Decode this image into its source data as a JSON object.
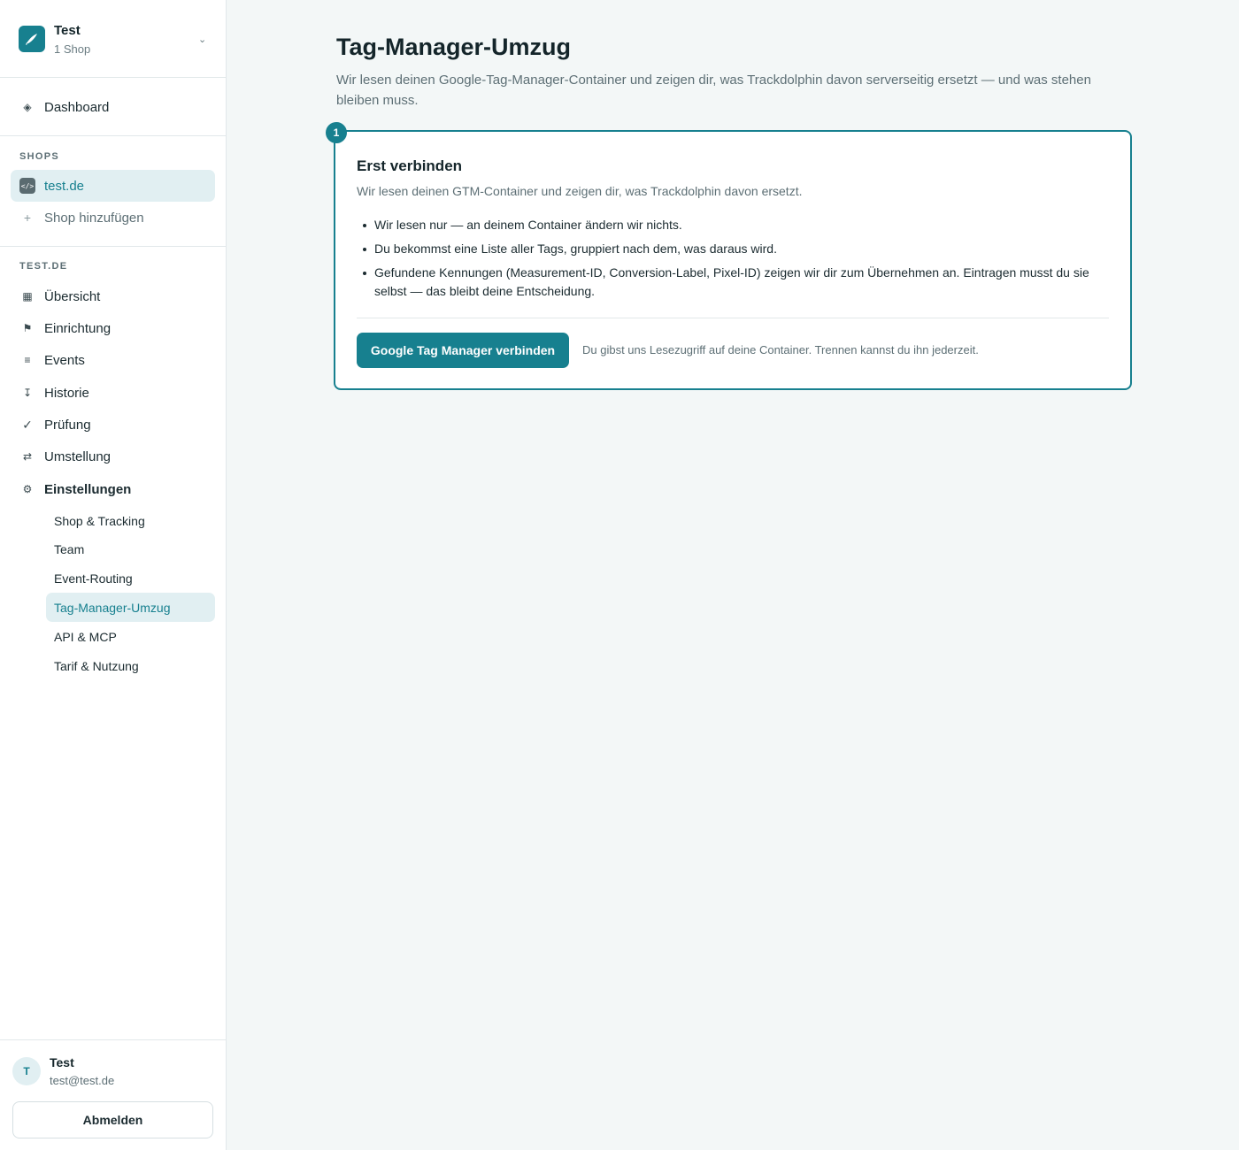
{
  "org": {
    "name": "Test",
    "sub": "1 Shop"
  },
  "nav": {
    "dashboard": "Dashboard"
  },
  "shops": {
    "label": "SHOPS",
    "current": "test.de",
    "badge": "</>",
    "add": "Shop hinzufügen"
  },
  "shop_section": {
    "label": "TEST.DE",
    "items": [
      {
        "label": "Übersicht",
        "icon": "grid-icon"
      },
      {
        "label": "Einrichtung",
        "icon": "flag-icon"
      },
      {
        "label": "Events",
        "icon": "list-icon"
      },
      {
        "label": "Historie",
        "icon": "history-icon"
      },
      {
        "label": "Prüfung",
        "icon": "check-icon"
      },
      {
        "label": "Umstellung",
        "icon": "swap-icon"
      },
      {
        "label": "Einstellungen",
        "icon": "gear-icon"
      }
    ],
    "settings": [
      "Shop & Tracking",
      "Team",
      "Event-Routing",
      "Tag-Manager-Umzug",
      "API & MCP",
      "Tarif & Nutzung"
    ]
  },
  "user": {
    "initial": "T",
    "name": "Test",
    "email": "test@test.de",
    "logout": "Abmelden"
  },
  "page": {
    "title": "Tag-Manager-Umzug",
    "description": "Wir lesen deinen Google-Tag-Manager-Container und zeigen dir, was Trackdolphin davon serverseitig ersetzt — und was stehen bleiben muss."
  },
  "card": {
    "step": "1",
    "title": "Erst verbinden",
    "subtitle": "Wir lesen deinen GTM-Container und zeigen dir, was Trackdolphin davon ersetzt.",
    "bullets": [
      "Wir lesen nur — an deinem Container ändern wir nichts.",
      "Du bekommst eine Liste aller Tags, gruppiert nach dem, was daraus wird.",
      "Gefundene Kennungen (Measurement-ID, Conversion-Label, Pixel-ID) zeigen wir dir zum Übernehmen an. Eintragen musst du sie selbst — das bleibt deine Entscheidung."
    ],
    "button": "Google Tag Manager verbinden",
    "note": "Du gibst uns Lesezugriff auf deine Container. Trennen kannst du ihn jederzeit."
  },
  "colors": {
    "accent": "#17808f",
    "background": "#f3f7f7",
    "active_bg": "#e1eff2"
  }
}
